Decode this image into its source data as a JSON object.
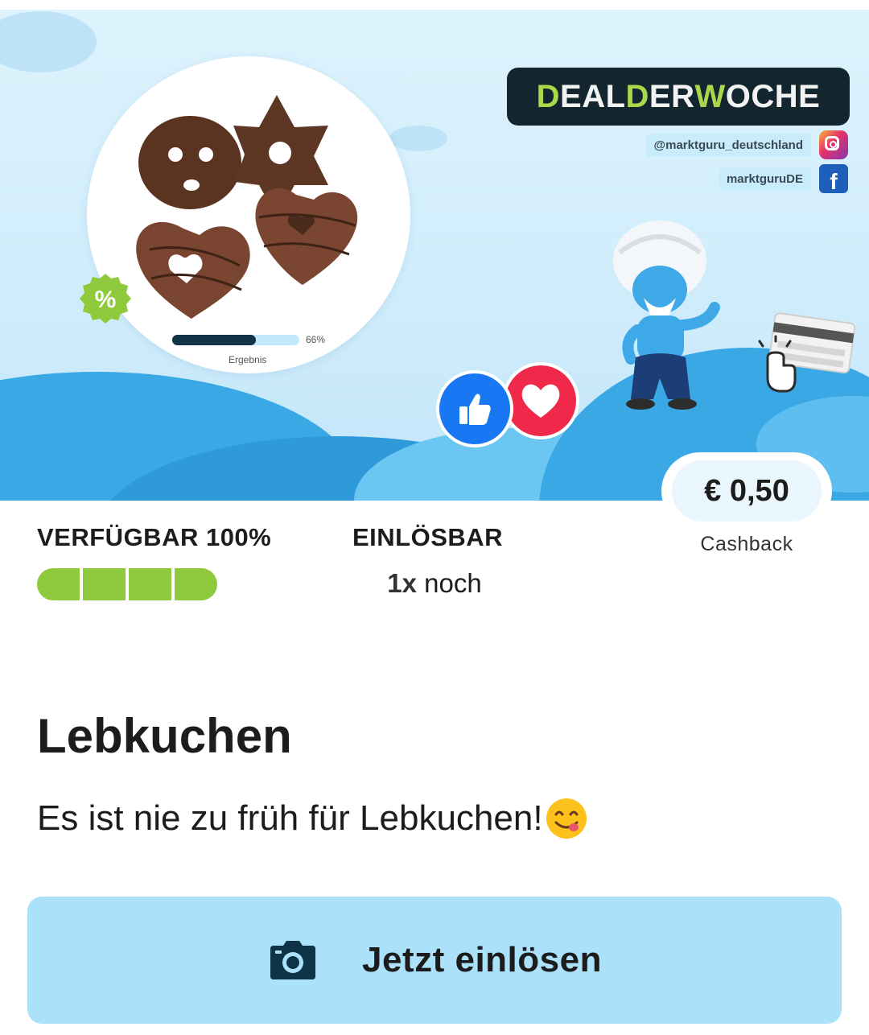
{
  "banner": {
    "deal_title_part1": "D",
    "deal_title_part2": "EAL ",
    "deal_title_part3": "D",
    "deal_title_part4": "ER ",
    "deal_title_part5": "W",
    "deal_title_part6": "OCHE",
    "instagram_handle": "@marktguru_deutschland",
    "facebook_handle": "marktguruDE",
    "result_percent": "66%",
    "result_fraction": 0.66,
    "result_label": "Ergebnis",
    "discount_symbol": "%",
    "icons": [
      "percent-badge-icon",
      "instagram-icon",
      "facebook-icon",
      "like-icon",
      "heart-icon",
      "card-icon",
      "hand-pointer-icon",
      "camera-icon"
    ]
  },
  "cashback": {
    "amount": "€ 0,50",
    "label": "Cashback"
  },
  "stats": {
    "available_label": "VERFÜGBAR 100%",
    "available_fraction": 1.0,
    "segments": 4,
    "redeemable_label": "EINLÖSBAR",
    "redeemable_count": "1x",
    "redeemable_suffix": " noch"
  },
  "offer": {
    "title": "Lebkuchen",
    "description": "Es ist nie zu früh für Lebkuchen!"
  },
  "cta": {
    "label": "Jetzt einlösen"
  },
  "colors": {
    "sky": "#cfecfb",
    "cloud_blue": "#3aa7e4",
    "deal_badge": "#13262f",
    "deal_green": "#a9d84a",
    "segment_green": "#8fca3d",
    "cta_bg": "#abe2f9",
    "camera_icon": "#0f3347"
  }
}
